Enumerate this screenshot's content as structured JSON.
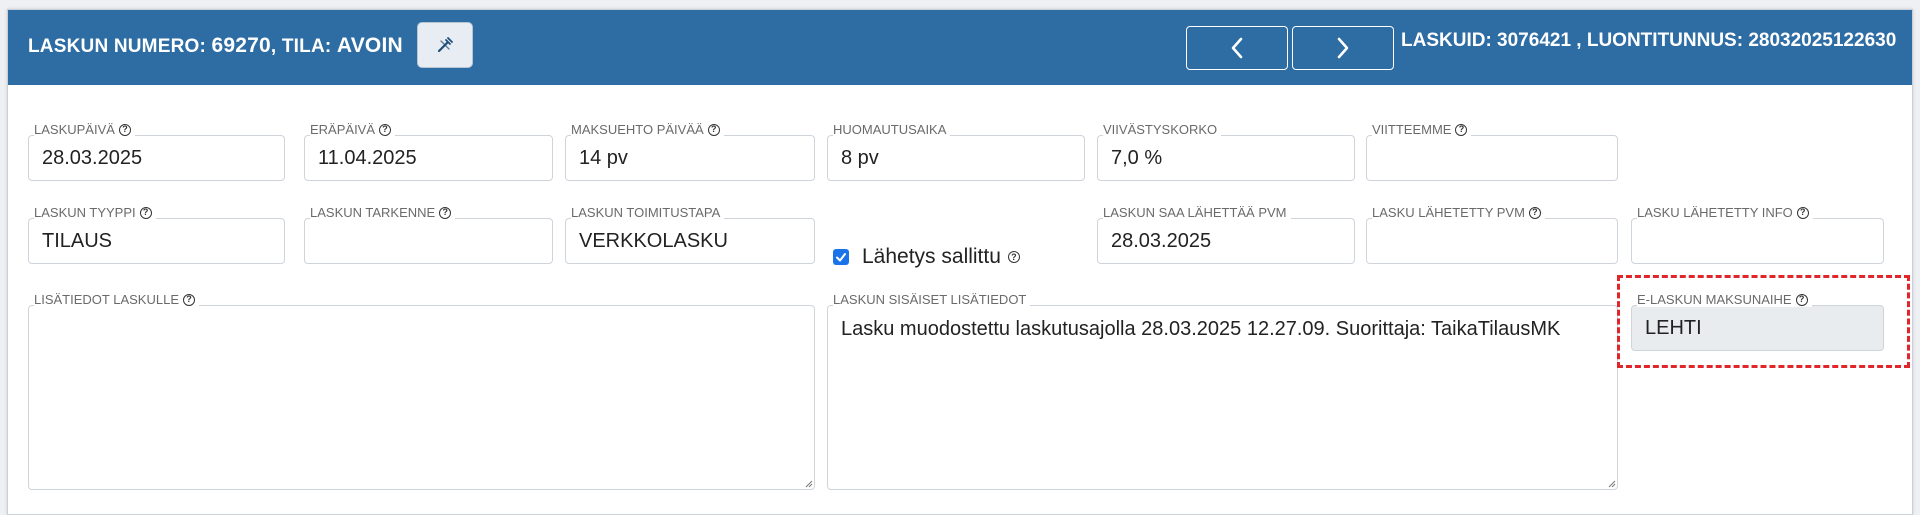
{
  "header": {
    "title_prefix": "LASKUN NUMERO: ",
    "invoice_number": "69270",
    "title_mid": ", TILA: ",
    "status": "AVOIN",
    "ids": "LASKUID: 3076421 , LUONTITUNNUS: 28032025122630"
  },
  "fields": {
    "laskupaiva": {
      "label": "LASKUPÄIVÄ",
      "value": "28.03.2025"
    },
    "erapaiva": {
      "label": "ERÄPÄIVÄ",
      "value": "11.04.2025"
    },
    "maksuehto": {
      "label": "MAKSUEHTO PÄIVÄÄ",
      "value": "14 pv"
    },
    "huomautusaika": {
      "label": "HUOMAUTUSAIKA",
      "value": "8 pv"
    },
    "viivastyskorko": {
      "label": "VIIVÄSTYSKORKO",
      "value": "7,0 %"
    },
    "viitteemme": {
      "label": "VIITTEEMME",
      "value": ""
    },
    "laskun_tyyppi": {
      "label": "LASKUN TYYPPI",
      "value": "TILAUS"
    },
    "laskun_tarkenne": {
      "label": "LASKUN TARKENNE",
      "value": ""
    },
    "toimitustapa": {
      "label": "LASKUN TOIMITUSTAPA",
      "value": "VERKKOLASKU"
    },
    "lahetys_sallittu": {
      "label": "Lähetys sallittu",
      "checked": true
    },
    "saa_lahettaa": {
      "label": "LASKUN SAA LÄHETTÄÄ PVM",
      "value": "28.03.2025"
    },
    "lahetetty_pvm": {
      "label": "LASKU LÄHETETTY PVM",
      "value": ""
    },
    "lahetetty_info": {
      "label": "LASKU LÄHETETTY INFO",
      "value": ""
    },
    "lisatiedot": {
      "label": "LISÄTIEDOT LASKULLE",
      "value": ""
    },
    "sisaiset": {
      "label": "LASKUN SISÄISET LISÄTIEDOT",
      "value": "Lasku muodostettu laskutusajolla 28.03.2025 12.27.09. Suorittaja: TaikaTilausMK"
    },
    "e_maksunaihe": {
      "label": "E-LASKUN MAKSUNAIHE",
      "value": "LEHTI"
    }
  },
  "help_glyph": "?",
  "colors": {
    "header": "#2e6ca4",
    "highlight": "#e0262b",
    "checkbox": "#1a73e8"
  }
}
